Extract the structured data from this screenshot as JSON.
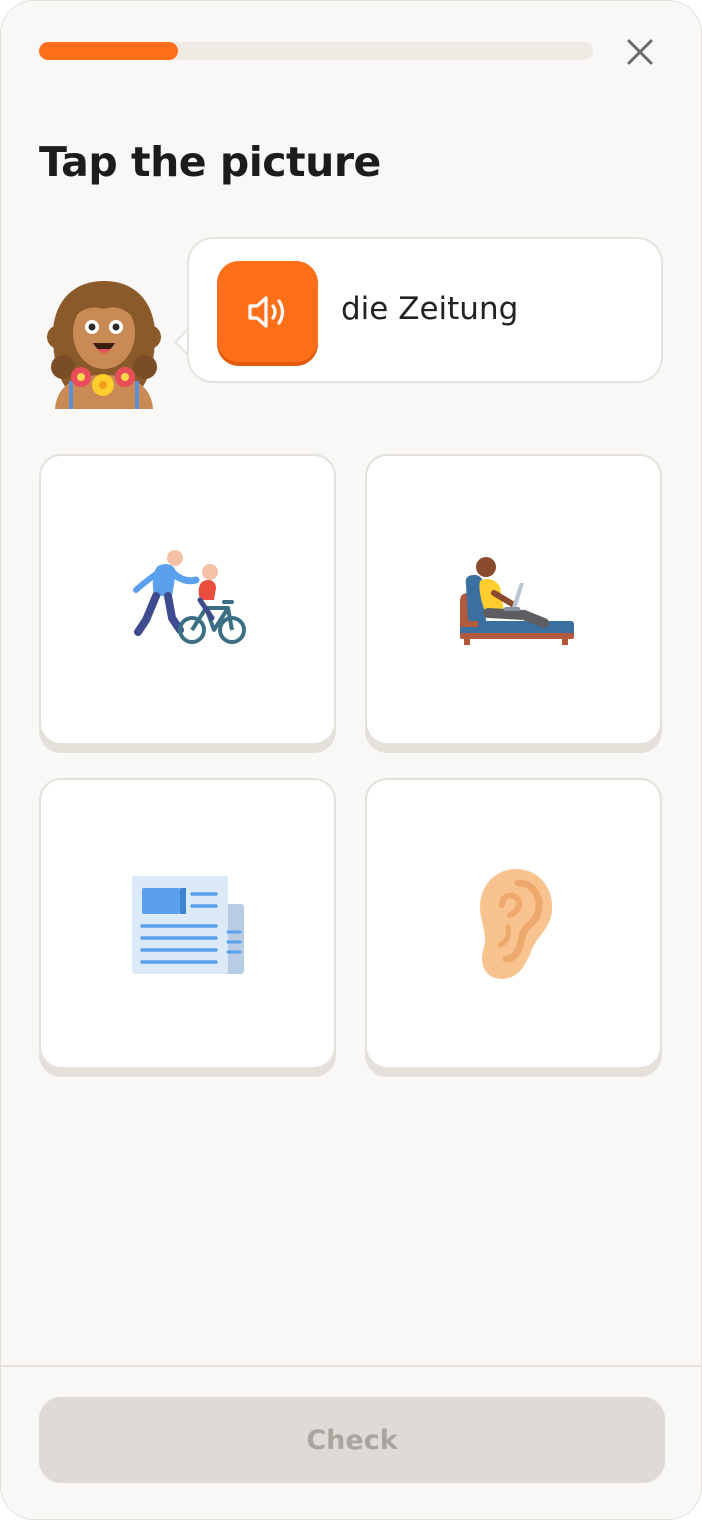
{
  "lesson": {
    "progress_fraction": 0.25,
    "title": "Tap the picture"
  },
  "prompt": {
    "word": "die Zeitung",
    "speaker_icon": "speaker-icon"
  },
  "choices": [
    {
      "id": "bike",
      "icon": "parent-teaching-child-bike-icon"
    },
    {
      "id": "recline",
      "icon": "person-reclining-with-laptop-icon"
    },
    {
      "id": "newspaper",
      "icon": "newspaper-icon"
    },
    {
      "id": "ear",
      "icon": "ear-icon"
    }
  ],
  "footer": {
    "check_label": "Check",
    "check_enabled": false
  },
  "colors": {
    "accent": "#ff6f1a",
    "background": "#f9f8f6",
    "disabled_button": "#dedbd6",
    "disabled_text": "#a9a6a0"
  }
}
